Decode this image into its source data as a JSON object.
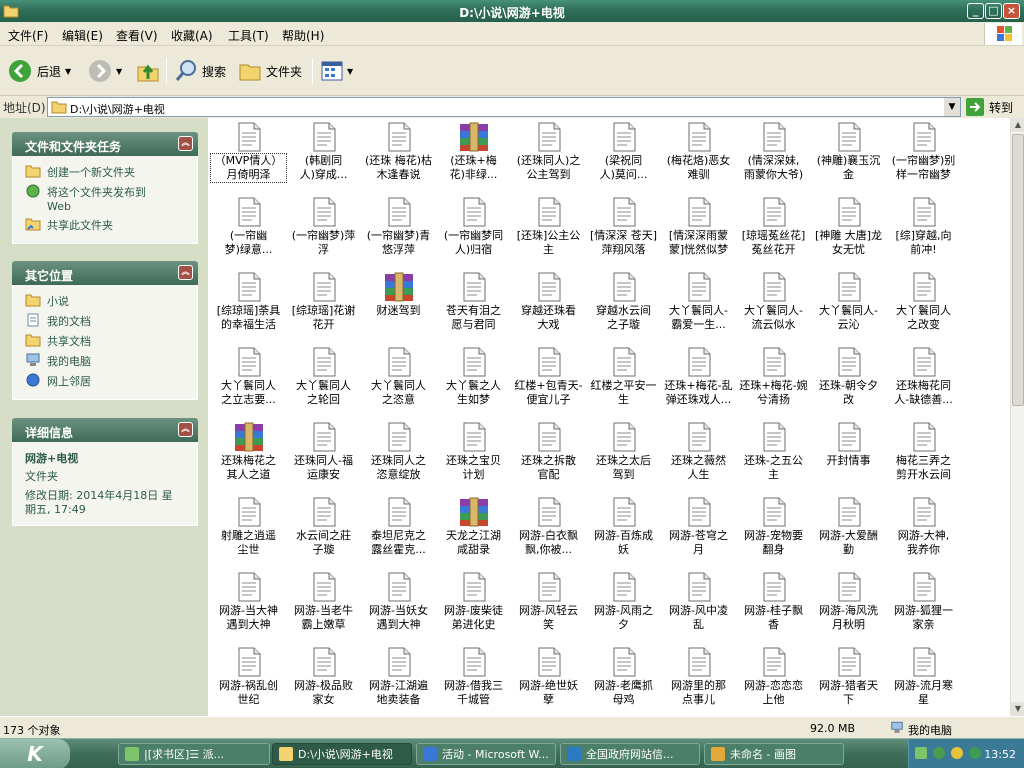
{
  "window": {
    "title": "D:\\小说\\网游+电视",
    "min": "_",
    "max": "□",
    "close": "×"
  },
  "menu": [
    "文件(F)",
    "编辑(E)",
    "查看(V)",
    "收藏(A)",
    "工具(T)",
    "帮助(H)"
  ],
  "toolbar": {
    "back": "后退",
    "search": "搜索",
    "folders": "文件夹"
  },
  "address": {
    "label": "地址(D)",
    "path": "D:\\小说\\网游+电视",
    "go": "转到"
  },
  "tasks": {
    "title": "文件和文件夹任务",
    "items": [
      "创建一个新文件夹",
      "将这个文件夹发布到\nWeb",
      "共享此文件夹"
    ]
  },
  "places": {
    "title": "其它位置",
    "items": [
      "小说",
      "我的文档",
      "共享文档",
      "我的电脑",
      "网上邻居"
    ]
  },
  "details": {
    "title": "详细信息",
    "name": "网游+电视",
    "type": "文件夹",
    "modified": "修改日期: 2014年4月18日 星\n期五, 17:49"
  },
  "files": [
    {
      "l": "（MVP情人）\n月倚明泽",
      "t": "txt"
    },
    {
      "l": "(韩剧同\n人)穿成...",
      "t": "txt"
    },
    {
      "l": "(还珠 梅花)枯\n木逢春说",
      "t": "txt"
    },
    {
      "l": "(还珠+梅\n花)非绿...",
      "t": "rar"
    },
    {
      "l": "(还珠同人)之\n公主驾到",
      "t": "txt"
    },
    {
      "l": "(梁祝同\n人)莫问...",
      "t": "txt"
    },
    {
      "l": "(梅花烙)恶女\n难驯",
      "t": "txt"
    },
    {
      "l": "(情深深妹,\n雨蒙你大爷)",
      "t": "txt"
    },
    {
      "l": "(神雕)襄玉沉\n金",
      "t": "txt"
    },
    {
      "l": "(一帘幽梦)别\n样一帘幽梦",
      "t": "txt"
    },
    {
      "l": "(一帘幽\n梦)绿意...",
      "t": "txt"
    },
    {
      "l": "(一帘幽梦)萍\n浮",
      "t": "txt"
    },
    {
      "l": "(一帘幽梦)青\n悠浮萍",
      "t": "txt"
    },
    {
      "l": "(一帘幽梦同\n人)归宿",
      "t": "txt"
    },
    {
      "l": "[还珠]公主公\n主",
      "t": "txt"
    },
    {
      "l": "[情深深 苍天]\n萍翔风落",
      "t": "txt"
    },
    {
      "l": "[情深深雨蒙\n蒙]恍然似梦",
      "t": "txt"
    },
    {
      "l": "[琼瑶菟丝花]\n菟丝花开",
      "t": "txt"
    },
    {
      "l": "[神雕 大唐]龙\n女无忧",
      "t": "txt"
    },
    {
      "l": "[综]穿越,向\n前冲!",
      "t": "txt"
    },
    {
      "l": "[综琼瑶]荼具\n的幸福生活",
      "t": "txt"
    },
    {
      "l": "[综琼瑶]花谢\n花开",
      "t": "txt"
    },
    {
      "l": "财迷驾到",
      "t": "rar"
    },
    {
      "l": "苍天有泪之\n愿与君同",
      "t": "txt"
    },
    {
      "l": "穿越还珠看\n大戏",
      "t": "txt"
    },
    {
      "l": "穿越水云间\n之子璇",
      "t": "txt"
    },
    {
      "l": "大丫鬟同人-\n霸爱一生...",
      "t": "txt"
    },
    {
      "l": "大丫鬟同人-\n流云似水",
      "t": "txt"
    },
    {
      "l": "大丫鬟同人-\n云沁",
      "t": "txt"
    },
    {
      "l": "大丫鬟同人\n之改变",
      "t": "txt"
    },
    {
      "l": "大丫鬟同人\n之立志要...",
      "t": "txt"
    },
    {
      "l": "大丫鬟同人\n之轮回",
      "t": "txt"
    },
    {
      "l": "大丫鬟同人\n之恣意",
      "t": "txt"
    },
    {
      "l": "大丫鬟之人\n生如梦",
      "t": "txt"
    },
    {
      "l": "红楼+包青天-\n便宜儿子",
      "t": "txt"
    },
    {
      "l": "红楼之平安一\n生",
      "t": "txt"
    },
    {
      "l": "还珠+梅花-乱\n弹还珠戏人...",
      "t": "txt"
    },
    {
      "l": "还珠+梅花-婉\n兮清扬",
      "t": "txt"
    },
    {
      "l": "还珠-朝令夕\n改",
      "t": "txt"
    },
    {
      "l": "还珠梅花同\n人-缺德善...",
      "t": "txt"
    },
    {
      "l": "还珠梅花之\n其人之道",
      "t": "rar"
    },
    {
      "l": "还珠同人-福\n运康安",
      "t": "txt"
    },
    {
      "l": "还珠同人之\n恣意绽放",
      "t": "txt"
    },
    {
      "l": "还珠之宝贝\n计划",
      "t": "txt"
    },
    {
      "l": "还珠之拆散\n官配",
      "t": "txt"
    },
    {
      "l": "还珠之太后\n驾到",
      "t": "txt"
    },
    {
      "l": "还珠之薇然\n人生",
      "t": "txt"
    },
    {
      "l": "还珠-之五公\n主",
      "t": "txt"
    },
    {
      "l": "开封情事",
      "t": "txt"
    },
    {
      "l": "梅花三弄之\n剪开水云间",
      "t": "txt"
    },
    {
      "l": "射雕之逍遥\n尘世",
      "t": "txt"
    },
    {
      "l": "水云间之莊\n子璇",
      "t": "txt"
    },
    {
      "l": "泰坦尼克之\n露丝霍克...",
      "t": "txt"
    },
    {
      "l": "天龙之江湖\n咸甜录",
      "t": "rar"
    },
    {
      "l": "网游-白衣飘\n飘,你被...",
      "t": "txt"
    },
    {
      "l": "网游-百炼成\n妖",
      "t": "txt"
    },
    {
      "l": "网游-苍穹之\n月",
      "t": "txt"
    },
    {
      "l": "网游-宠物要\n翻身",
      "t": "txt"
    },
    {
      "l": "网游-大爱酬\n勤",
      "t": "txt"
    },
    {
      "l": "网游-大神,\n我养你",
      "t": "txt"
    },
    {
      "l": "网游-当大神\n遇到大神",
      "t": "txt"
    },
    {
      "l": "网游-当老牛\n霸上嫩草",
      "t": "txt"
    },
    {
      "l": "网游-当妖女\n遇到大神",
      "t": "txt"
    },
    {
      "l": "网游-废柴徒\n弟进化史",
      "t": "txt"
    },
    {
      "l": "网游-风轻云\n笑",
      "t": "txt"
    },
    {
      "l": "网游-风雨之\n夕",
      "t": "txt"
    },
    {
      "l": "网游-风中凌\n乱",
      "t": "txt"
    },
    {
      "l": "网游-桂子飘\n香",
      "t": "txt"
    },
    {
      "l": "网游-海风洗\n月秋明",
      "t": "txt"
    },
    {
      "l": "网游-狐狸一\n家亲",
      "t": "txt"
    },
    {
      "l": "网游-祸乱创\n世纪",
      "t": "txt"
    },
    {
      "l": "网游-极品败\n家女",
      "t": "txt"
    },
    {
      "l": "网游-江湖遍\n地卖装备",
      "t": "txt"
    },
    {
      "l": "网游-借我三\n千城管",
      "t": "txt"
    },
    {
      "l": "网游-绝世妖\n孽",
      "t": "txt"
    },
    {
      "l": "网游-老鹰抓\n母鸡",
      "t": "txt"
    },
    {
      "l": "网游里的那\n点事儿",
      "t": "txt"
    },
    {
      "l": "网游-恋恋恋\n上他",
      "t": "txt"
    },
    {
      "l": "网游-猎者天\n下",
      "t": "txt"
    },
    {
      "l": "网游-流月寒\n星",
      "t": "txt"
    }
  ],
  "status": {
    "count": "173 个对象",
    "size": "92.0 MB",
    "location": "我的电脑"
  },
  "taskbar": {
    "start": "K",
    "items": [
      "|[求书区]☰ 派...",
      "D:\\小说\\网游+电视",
      "活动 - Microsoft W...",
      "全国政府网站信...",
      "未命名 - 画图"
    ],
    "clock": "13:52"
  },
  "colors": {
    "title": "#2F6E58",
    "accent": "#3F6A58",
    "sidebar": "#D6DEC7"
  }
}
